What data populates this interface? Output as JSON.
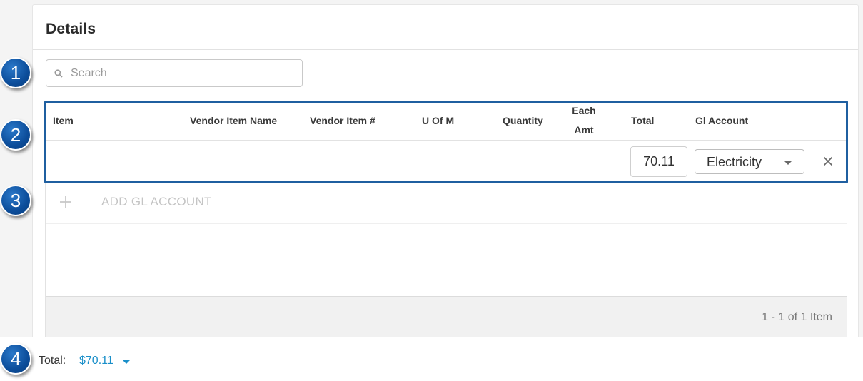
{
  "details": {
    "title": "Details",
    "search_placeholder": "Search"
  },
  "grid": {
    "columns": {
      "item": "Item",
      "vendor_item_name": "Vendor Item Name",
      "vendor_item_no": "Vendor Item #",
      "u_of_m": "U Of M",
      "quantity": "Quantity",
      "each_amt_line1": "Each",
      "each_amt_line2": "Amt",
      "total": "Total",
      "gl_account": "Gl Account"
    },
    "row": {
      "total": "70.11",
      "gl_account": "Electricity"
    },
    "add_label": "ADD GL ACCOUNT",
    "pager": "1 - 1 of 1 Item"
  },
  "summary": {
    "total_label": "Total:",
    "total_value": "$70.11"
  },
  "callouts": [
    "1",
    "2",
    "3",
    "4"
  ],
  "colors": {
    "callout_blue": "#0c4d9a",
    "highlight_border": "#1f5fa0",
    "link_blue": "#1a8fc9"
  }
}
